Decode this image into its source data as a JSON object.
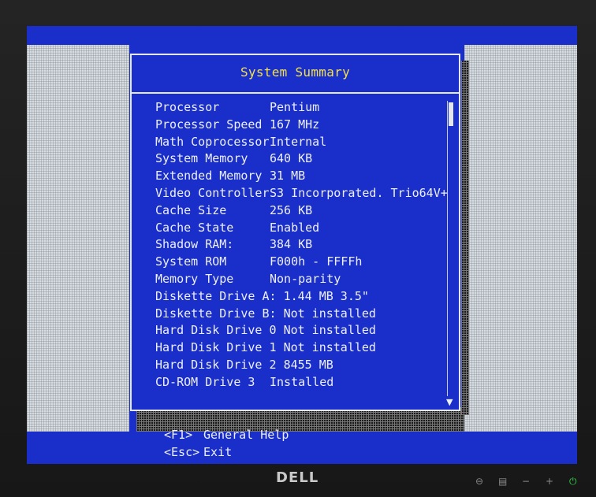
{
  "dialog": {
    "title": "System Summary"
  },
  "rows": [
    {
      "label": "Processor",
      "value": "Pentium"
    },
    {
      "label": "Processor Speed",
      "value": "167 MHz"
    },
    {
      "label": "Math Coprocessor",
      "value": "Internal"
    },
    {
      "label": "System Memory",
      "value": "640 KB"
    },
    {
      "label": "Extended Memory",
      "value": "31 MB"
    },
    {
      "label": "Video Controller",
      "value": "S3 Incorporated. Trio64V+"
    },
    {
      "label": "Cache Size",
      "value": "256 KB"
    },
    {
      "label": "Cache State",
      "value": "Enabled"
    },
    {
      "label": "Shadow RAM:",
      "value": "384 KB"
    },
    {
      "label": "System ROM",
      "value": "F000h - FFFFh"
    },
    {
      "label": "Memory Type",
      "value": "Non-parity"
    },
    {
      "label": "Diskette Drive A:",
      "value": "1.44 MB 3.5\""
    },
    {
      "label": "Diskette Drive B:",
      "value": "Not installed"
    },
    {
      "label": "Hard Disk Drive 0",
      "value": "Not installed"
    },
    {
      "label": "Hard Disk Drive 1",
      "value": "Not installed"
    },
    {
      "label": "Hard Disk Drive 2",
      "value": "8455 MB"
    },
    {
      "label": "CD-ROM Drive 3",
      "value": "Installed"
    }
  ],
  "help": [
    {
      "key": "<F1>",
      "action": "General Help"
    },
    {
      "key": "<Esc>",
      "action": "Exit"
    }
  ],
  "monitor": {
    "brand": "DELL"
  },
  "colors": {
    "bios_blue": "#1a2fc9",
    "title_yellow": "#f4e04a",
    "text": "#eef0f8"
  }
}
